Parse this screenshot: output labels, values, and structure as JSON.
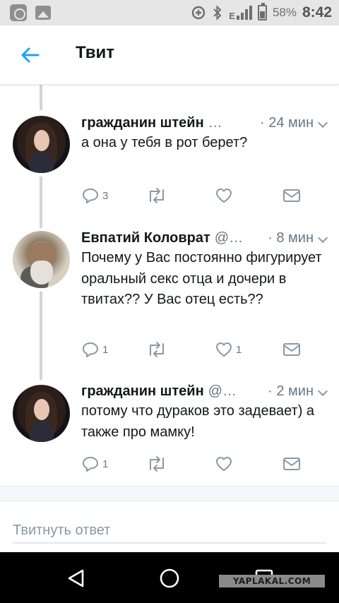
{
  "status_bar": {
    "icons": [
      "app-notification-icon",
      "gallery-icon",
      "data-saver-icon",
      "bluetooth-icon",
      "signal-icon",
      "battery-icon"
    ],
    "network_label": "E",
    "battery_percent": "58%",
    "battery_level": 0.58,
    "time": "8:42"
  },
  "header": {
    "back_icon": "arrow-left-icon",
    "title": "Твит"
  },
  "colors": {
    "accent": "#1da1f2",
    "text": "#14171a",
    "secondary_text": "#657786",
    "icon_gray": "#8899a6",
    "thread_line": "#ccd6dd"
  },
  "tweets": [
    {
      "author": "гражданин штейн",
      "handle": "…",
      "time": "· 24 мин",
      "text": "а она у тебя в рот берет?",
      "avatar": "girl-avatar",
      "replies": "3",
      "retweets": "",
      "likes": ""
    },
    {
      "author": "Евпатий Коловрат",
      "handle": "@…",
      "time": "· 8 мин",
      "text": "Почему у Вас постоянно фигурирует оральный секс отца и дочери в твитах?? У Вас отец есть??",
      "avatar": "old-man-avatar",
      "replies": "1",
      "retweets": "",
      "likes": "1"
    },
    {
      "author": "гражданин штейн",
      "handle": "@…",
      "time": "· 2 мин",
      "text": "потому что дураков это задевает) а также про мамку!",
      "avatar": "girl-avatar",
      "replies": "1",
      "retweets": "",
      "likes": ""
    }
  ],
  "reply": {
    "placeholder": "Твитнуть ответ"
  },
  "nav_bar": {
    "buttons": [
      "back-triangle-icon",
      "home-circle-icon",
      "recents-square-icon"
    ]
  },
  "watermark": "YAPLAKAL.COM"
}
